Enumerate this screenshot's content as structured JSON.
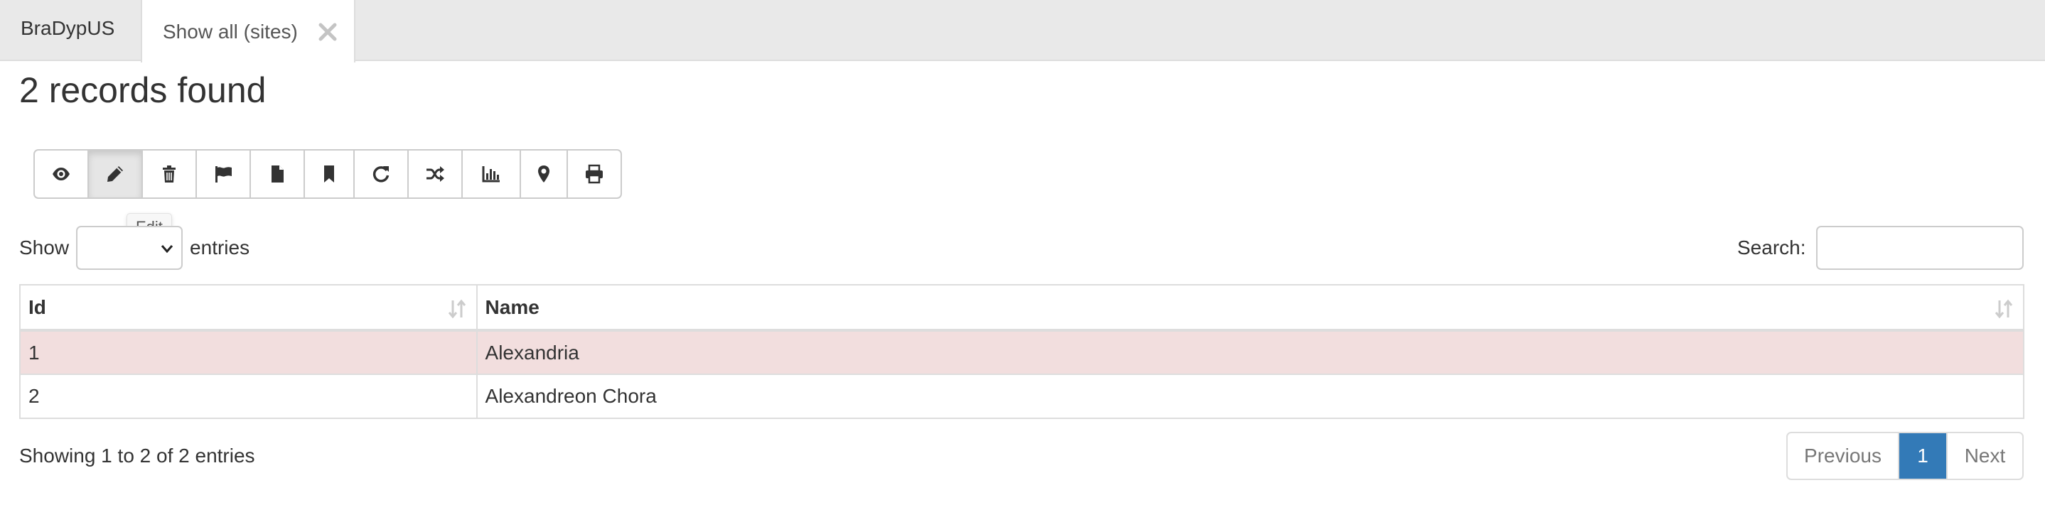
{
  "tabs": {
    "brand": "BraDypUS",
    "active_tab": "Show all (sites)"
  },
  "page": {
    "title": "2 records found"
  },
  "toolbar": {
    "buttons": [
      {
        "icon": "eye-icon"
      },
      {
        "icon": "pencil-icon",
        "active": true
      },
      {
        "icon": "trash-icon"
      },
      {
        "icon": "flag-icon"
      },
      {
        "icon": "file-icon"
      },
      {
        "icon": "bookmark-icon"
      },
      {
        "icon": "refresh-icon"
      },
      {
        "icon": "random-icon"
      },
      {
        "icon": "bar-chart-icon"
      },
      {
        "icon": "map-marker-icon"
      },
      {
        "icon": "print-icon"
      }
    ],
    "tooltip": "Edit"
  },
  "length_control": {
    "show_label": "Show",
    "selected": "",
    "entries_label": "entries"
  },
  "search": {
    "label": "Search:",
    "value": ""
  },
  "table": {
    "columns": [
      "Id",
      "Name"
    ],
    "rows": [
      {
        "id": "1",
        "name": "Alexandria",
        "highlighted": true
      },
      {
        "id": "2",
        "name": "Alexandreon Chora",
        "highlighted": false
      }
    ]
  },
  "footer": {
    "info": "Showing 1 to 2 of 2 entries",
    "pagination": {
      "previous": "Previous",
      "current": "1",
      "next": "Next"
    }
  },
  "colors": {
    "tab_bar": "#e9e9e9",
    "highlight_row": "#f2dede",
    "page_active": "#337ab7"
  }
}
